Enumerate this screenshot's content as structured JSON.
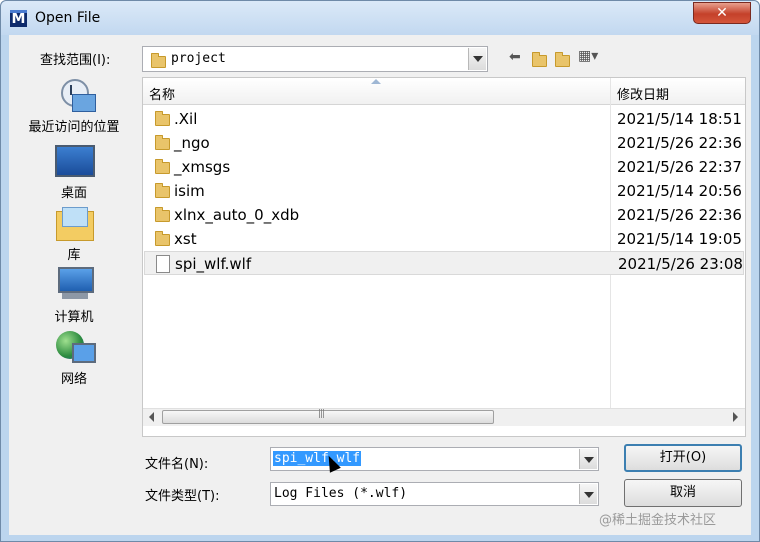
{
  "window": {
    "title": "Open File",
    "close_symbol": "✕"
  },
  "lookin": {
    "label": "查找范围(I):",
    "value": "project"
  },
  "header": {
    "name": "名称",
    "date": "修改日期"
  },
  "places": [
    {
      "label": "最近访问的位置",
      "icon": "recent-places-icon"
    },
    {
      "label": "桌面",
      "icon": "desktop-icon"
    },
    {
      "label": "库",
      "icon": "libraries-icon"
    },
    {
      "label": "计算机",
      "icon": "computer-icon"
    },
    {
      "label": "网络",
      "icon": "network-icon"
    }
  ],
  "files": [
    {
      "name": ".Xil",
      "date": "2021/5/14 18:51",
      "kind": "folder"
    },
    {
      "name": "_ngo",
      "date": "2021/5/26 22:36",
      "kind": "folder"
    },
    {
      "name": "_xmsgs",
      "date": "2021/5/26 22:37",
      "kind": "folder"
    },
    {
      "name": "isim",
      "date": "2021/5/14 20:56",
      "kind": "folder"
    },
    {
      "name": "xlnx_auto_0_xdb",
      "date": "2021/5/26 22:36",
      "kind": "folder"
    },
    {
      "name": "xst",
      "date": "2021/5/14 19:05",
      "kind": "folder"
    },
    {
      "name": "spi_wlf.wlf",
      "date": "2021/5/26 23:08",
      "kind": "file"
    }
  ],
  "filename": {
    "label": "文件名(N):",
    "value": "spi_wlf.wlf"
  },
  "filetype": {
    "label": "文件类型(T):",
    "value": "Log Files (*.wlf)"
  },
  "buttons": {
    "open": "打开(O)",
    "cancel": "取消"
  },
  "watermark": "@稀土掘金技术社区"
}
